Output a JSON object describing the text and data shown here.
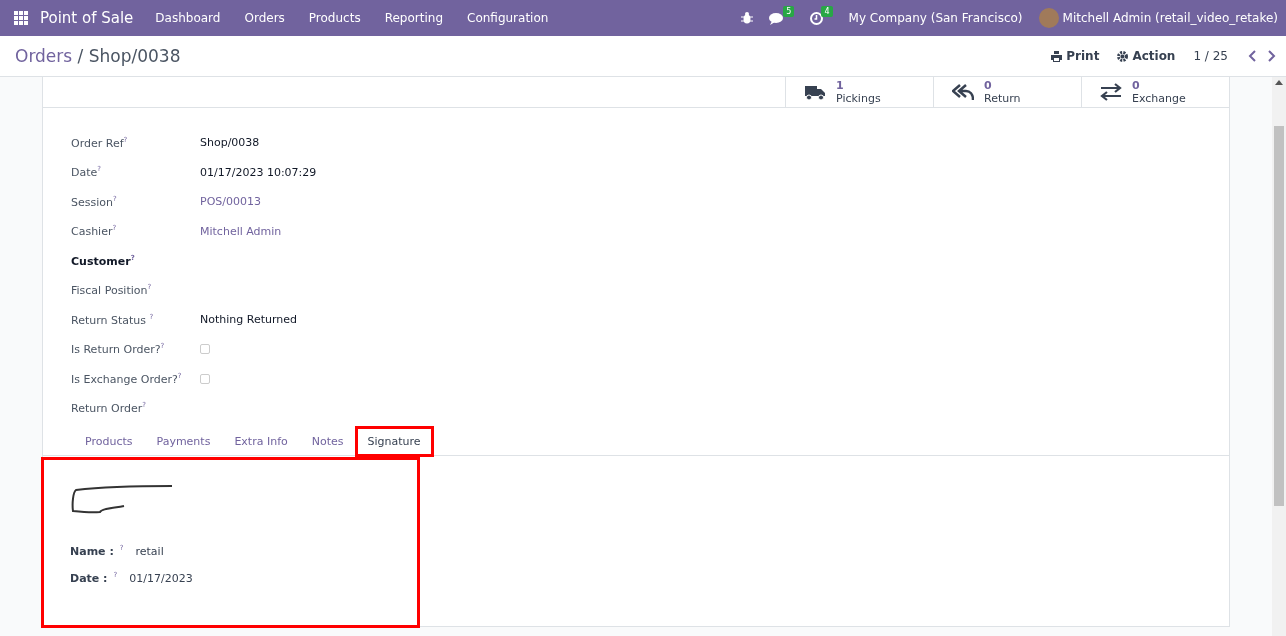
{
  "navbar": {
    "app_name": "Point of Sale",
    "menu": [
      "Dashboard",
      "Orders",
      "Products",
      "Reporting",
      "Configuration"
    ],
    "messages_count": "5",
    "activities_count": "4",
    "company": "My Company (San Francisco)",
    "user": "Mitchell Admin (retail_video_retake)"
  },
  "control_panel": {
    "breadcrumb": [
      {
        "label": "Orders",
        "kind": "link"
      },
      {
        "label": " / ",
        "kind": "sep"
      },
      {
        "label": "Shop/0038",
        "kind": "current"
      }
    ],
    "print": "Print",
    "action": "Action",
    "pager": "1 / 25"
  },
  "smart_buttons": [
    {
      "kind": "truck",
      "count": "1",
      "label": "Pickings"
    },
    {
      "kind": "return",
      "count": "0",
      "label": "Return"
    },
    {
      "kind": "exchange",
      "count": "0",
      "label": "Exchange"
    }
  ],
  "fields": [
    {
      "label": "Order Ref$^{?}$",
      "kind": "text",
      "value": "Shop/0038",
      "bold": false
    },
    {
      "label": "Date$^{?}$",
      "kind": "text",
      "value": "01/17/2023 10:07:29",
      "bold": false
    },
    {
      "label": "Session$^{?}$",
      "kind": "link",
      "value": "POS/00013",
      "bold": false
    },
    {
      "label": "Cashier$^{?}$",
      "kind": "link",
      "value": "Mitchell Admin",
      "bold": false
    },
    {
      "label": "Customer$^{?}$",
      "kind": "empty",
      "bold": true
    },
    {
      "label": "Fiscal Position$^{?}$",
      "kind": "empty",
      "bold": false
    },
    {
      "label": "Return Status  $^{?}$",
      "kind": "text",
      "value": "Nothing Returned",
      "bold": false
    },
    {
      "label": "Is Return Order?$^{?}$",
      "kind": "checkbox",
      "checked": false,
      "bold": false
    },
    {
      "label": "Is Exchange Order?$^{?}$",
      "kind": "checkbox",
      "checked": false,
      "bold": false
    },
    {
      "label": "Return Order$^{?}$",
      "kind": "empty",
      "bold": false
    }
  ],
  "tabs": [
    {
      "label": "Products",
      "selected": false
    },
    {
      "label": "Payments",
      "selected": false
    },
    {
      "label": "Extra Info",
      "selected": false
    },
    {
      "label": "Notes",
      "selected": false
    },
    {
      "label": "Signature",
      "selected": true,
      "highlighted": true
    }
  ],
  "signature": {
    "highlighted": true,
    "fields": [
      {
        "label": "Name :",
        "help": "?",
        "value": "retail"
      },
      {
        "label": "Date :",
        "help": "?",
        "value": "01/17/2023"
      }
    ]
  }
}
